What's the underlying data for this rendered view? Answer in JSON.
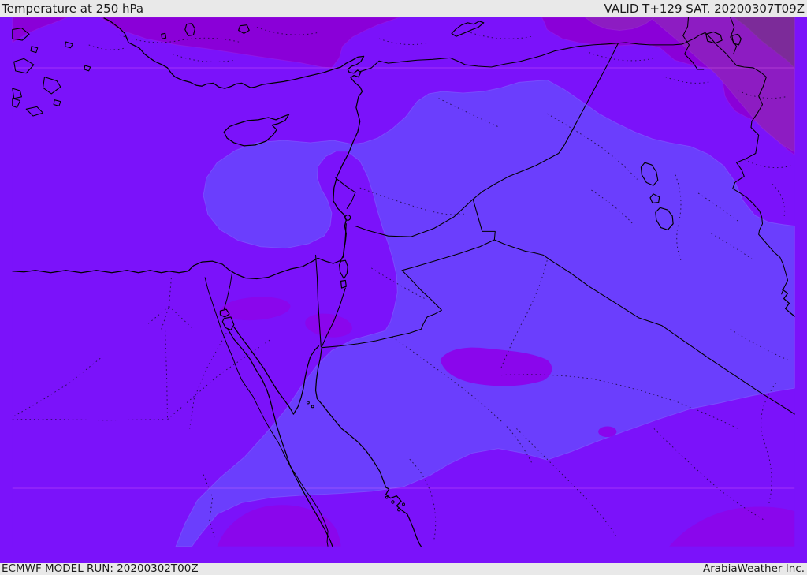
{
  "header": {
    "title": "Temperature at 250 hPa",
    "valid_label": "VALID T+129 SAT. 20200307T09Z"
  },
  "footer": {
    "model_run_label": "ECMWF MODEL RUN: 20200302T00Z",
    "credit": "ArabiaWeather Inc."
  },
  "map": {
    "kind": "temperature shading map, Middle East / Eastern Mediterranean",
    "palette": {
      "bar_background": "#e9e9e9",
      "bar_text": "#1a1a1a",
      "base_violet": "#7b12fa",
      "cool_light_violet": "#6b3efd",
      "warm_patch_violet": "#8a06ec",
      "band_dark1": "#8a00d8",
      "band_dark2": "#8d1cc2",
      "band_dark3": "#7c2b99",
      "coastline": "#000000",
      "light_edge": "#7e58ff",
      "dark_edge": "#9a22e8",
      "graticule": "rgba(255,130,245,0.30)"
    }
  }
}
